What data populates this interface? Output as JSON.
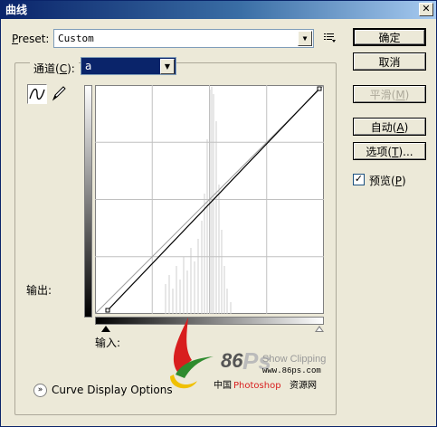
{
  "window": {
    "title": "曲线",
    "close_glyph": "✕"
  },
  "preset": {
    "label_first": "P",
    "label_rest": "reset:",
    "value": "Custom",
    "dropdown_glyph": "▼",
    "menu_icon": "list-menu-icon"
  },
  "channel": {
    "label": "通道(",
    "label_key": "C",
    "label_end": "):",
    "value": "a",
    "dropdown_glyph": "▼"
  },
  "tools": {
    "curve": "curve-tool-icon",
    "pencil": "pencil-tool-icon"
  },
  "graph": {
    "output_label": "输出:",
    "input_label": "输入:"
  },
  "buttons": {
    "ok": "确定",
    "cancel": "取消",
    "smooth": "平滑(",
    "smooth_key": "M",
    "smooth_end": ")",
    "auto": "自动(",
    "auto_key": "A",
    "auto_end": ")",
    "options": "选项(",
    "options_key": "T",
    "options_end": ")..."
  },
  "preview": {
    "checked_glyph": "✓",
    "label": "预览(",
    "label_key": "P",
    "label_end": ")"
  },
  "curve_display": {
    "glyph": "»",
    "label": "Curve Display Options"
  },
  "watermark": {
    "brand": "86",
    "brand_ps": "Ps",
    "tagline": "Show Clipping",
    "url": "www.86ps.com",
    "cn_a": "中国",
    "cn_b": "Photoshop",
    "cn_c": "资源网"
  }
}
